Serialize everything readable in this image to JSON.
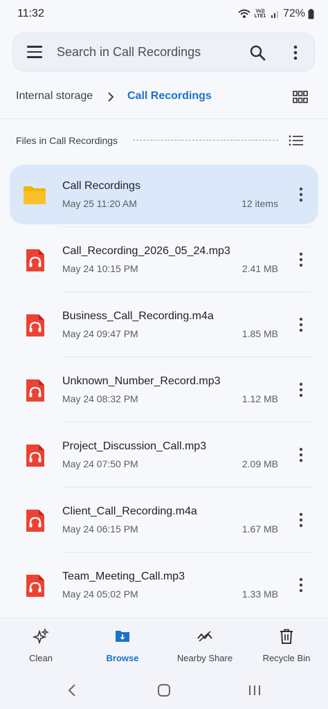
{
  "status_bar": {
    "time": "11:32",
    "network": "Vo)) LTE1",
    "battery": "72%"
  },
  "search": {
    "placeholder": "Search in Call Recordings"
  },
  "breadcrumb": {
    "root": "Internal storage",
    "current": "Call Recordings"
  },
  "files_header": "Files in Call Recordings",
  "folder": {
    "name": "Call Recordings",
    "date": "May 25   11:20 AM",
    "count": "12 items",
    "icon": "folder-icon"
  },
  "files": [
    {
      "name": "Call_Recording_2026_05_24.mp3",
      "date": "May 24   10:15 PM",
      "size": "2.41 MB"
    },
    {
      "name": "Business_Call_Recording.m4a",
      "date": "May 24   09:47 PM",
      "size": "1.85 MB"
    },
    {
      "name": "Unknown_Number_Record.mp3",
      "date": "May 24   08:32 PM",
      "size": "1.12 MB"
    },
    {
      "name": "Project_Discussion_Call.mp3",
      "date": "May 24   07:50 PM",
      "size": "2.09 MB"
    },
    {
      "name": "Client_Call_Recording.m4a",
      "date": "May 24   06:15 PM",
      "size": "1.67 MB"
    },
    {
      "name": "Team_Meeting_Call.mp3",
      "date": "May 24   05:02 PM",
      "size": "1.33 MB"
    }
  ],
  "bottom_nav": [
    {
      "label": "Clean",
      "icon": "sparkle-icon",
      "active": false
    },
    {
      "label": "Browse",
      "icon": "folder-icon",
      "active": true
    },
    {
      "label": "Nearby Share",
      "icon": "nearby-share-icon",
      "active": false
    },
    {
      "label": "Recycle Bin",
      "icon": "trash-icon",
      "active": false
    }
  ],
  "colors": {
    "accent": "#1a73c8",
    "folder": "#f4b400",
    "audio_file": "#ea4335",
    "selected_row": "#dbe8f9"
  }
}
